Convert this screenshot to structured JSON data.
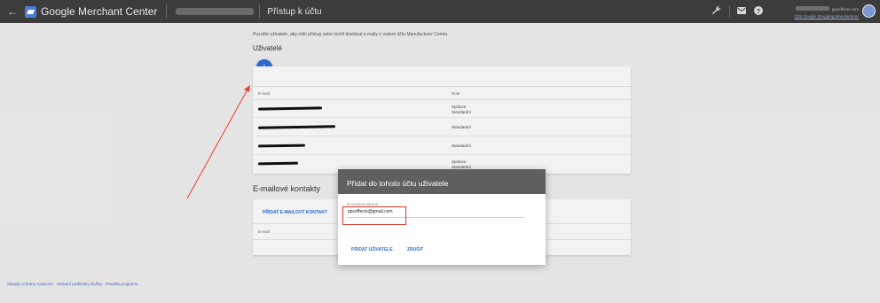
{
  "header": {
    "back_icon": "arrow-left-icon",
    "app_name": "Google Merchant Center",
    "page_title": "Přístup k účtu",
    "icons": [
      "wrench-icon",
      "mail-icon",
      "help-icon"
    ],
    "account_email": "ppceffects.com",
    "account_link": "(3D) Google Shopping Manufacturer"
  },
  "main": {
    "description": "Pozvěte uživatele, aby měli přístup nebo mohli dostávat e-maily o vašem účtu Manufacturer Center.",
    "users_title": "Uživatelé",
    "fab_label": "+",
    "users_table": {
      "col_email": "E-mail",
      "col_role": "Role",
      "rows": [
        {
          "role_1": "Správce",
          "role_2": "Standardní"
        },
        {
          "role_1": "Standardní",
          "role_2": ""
        },
        {
          "role_1": "Standardní",
          "role_2": ""
        },
        {
          "role_1": "Správce",
          "role_2": "Standardní"
        }
      ]
    },
    "contacts_title": "E-mailové kontakty",
    "add_contact_label": "PŘIDAT E-MAILOVÝ KONTAKT",
    "contacts_col_email": "E-mail"
  },
  "footer": {
    "links": "Zásady ochrany soukromí · Smluvní podmínky služby · Pravidla programu"
  },
  "dialog": {
    "title": "Přidat do tohoto účtu uživatele",
    "field_label": "E-mailová adresa",
    "field_value": "ppceffects@gmail.com",
    "add_label": "PŘIDAT UŽIVATELE",
    "cancel_label": "ZRUŠIT"
  },
  "colors": {
    "topbar": "#3c3c3c",
    "accent": "#2f6fd6",
    "highlight": "#d9342b",
    "dialog_header": "#5f5f5f"
  }
}
